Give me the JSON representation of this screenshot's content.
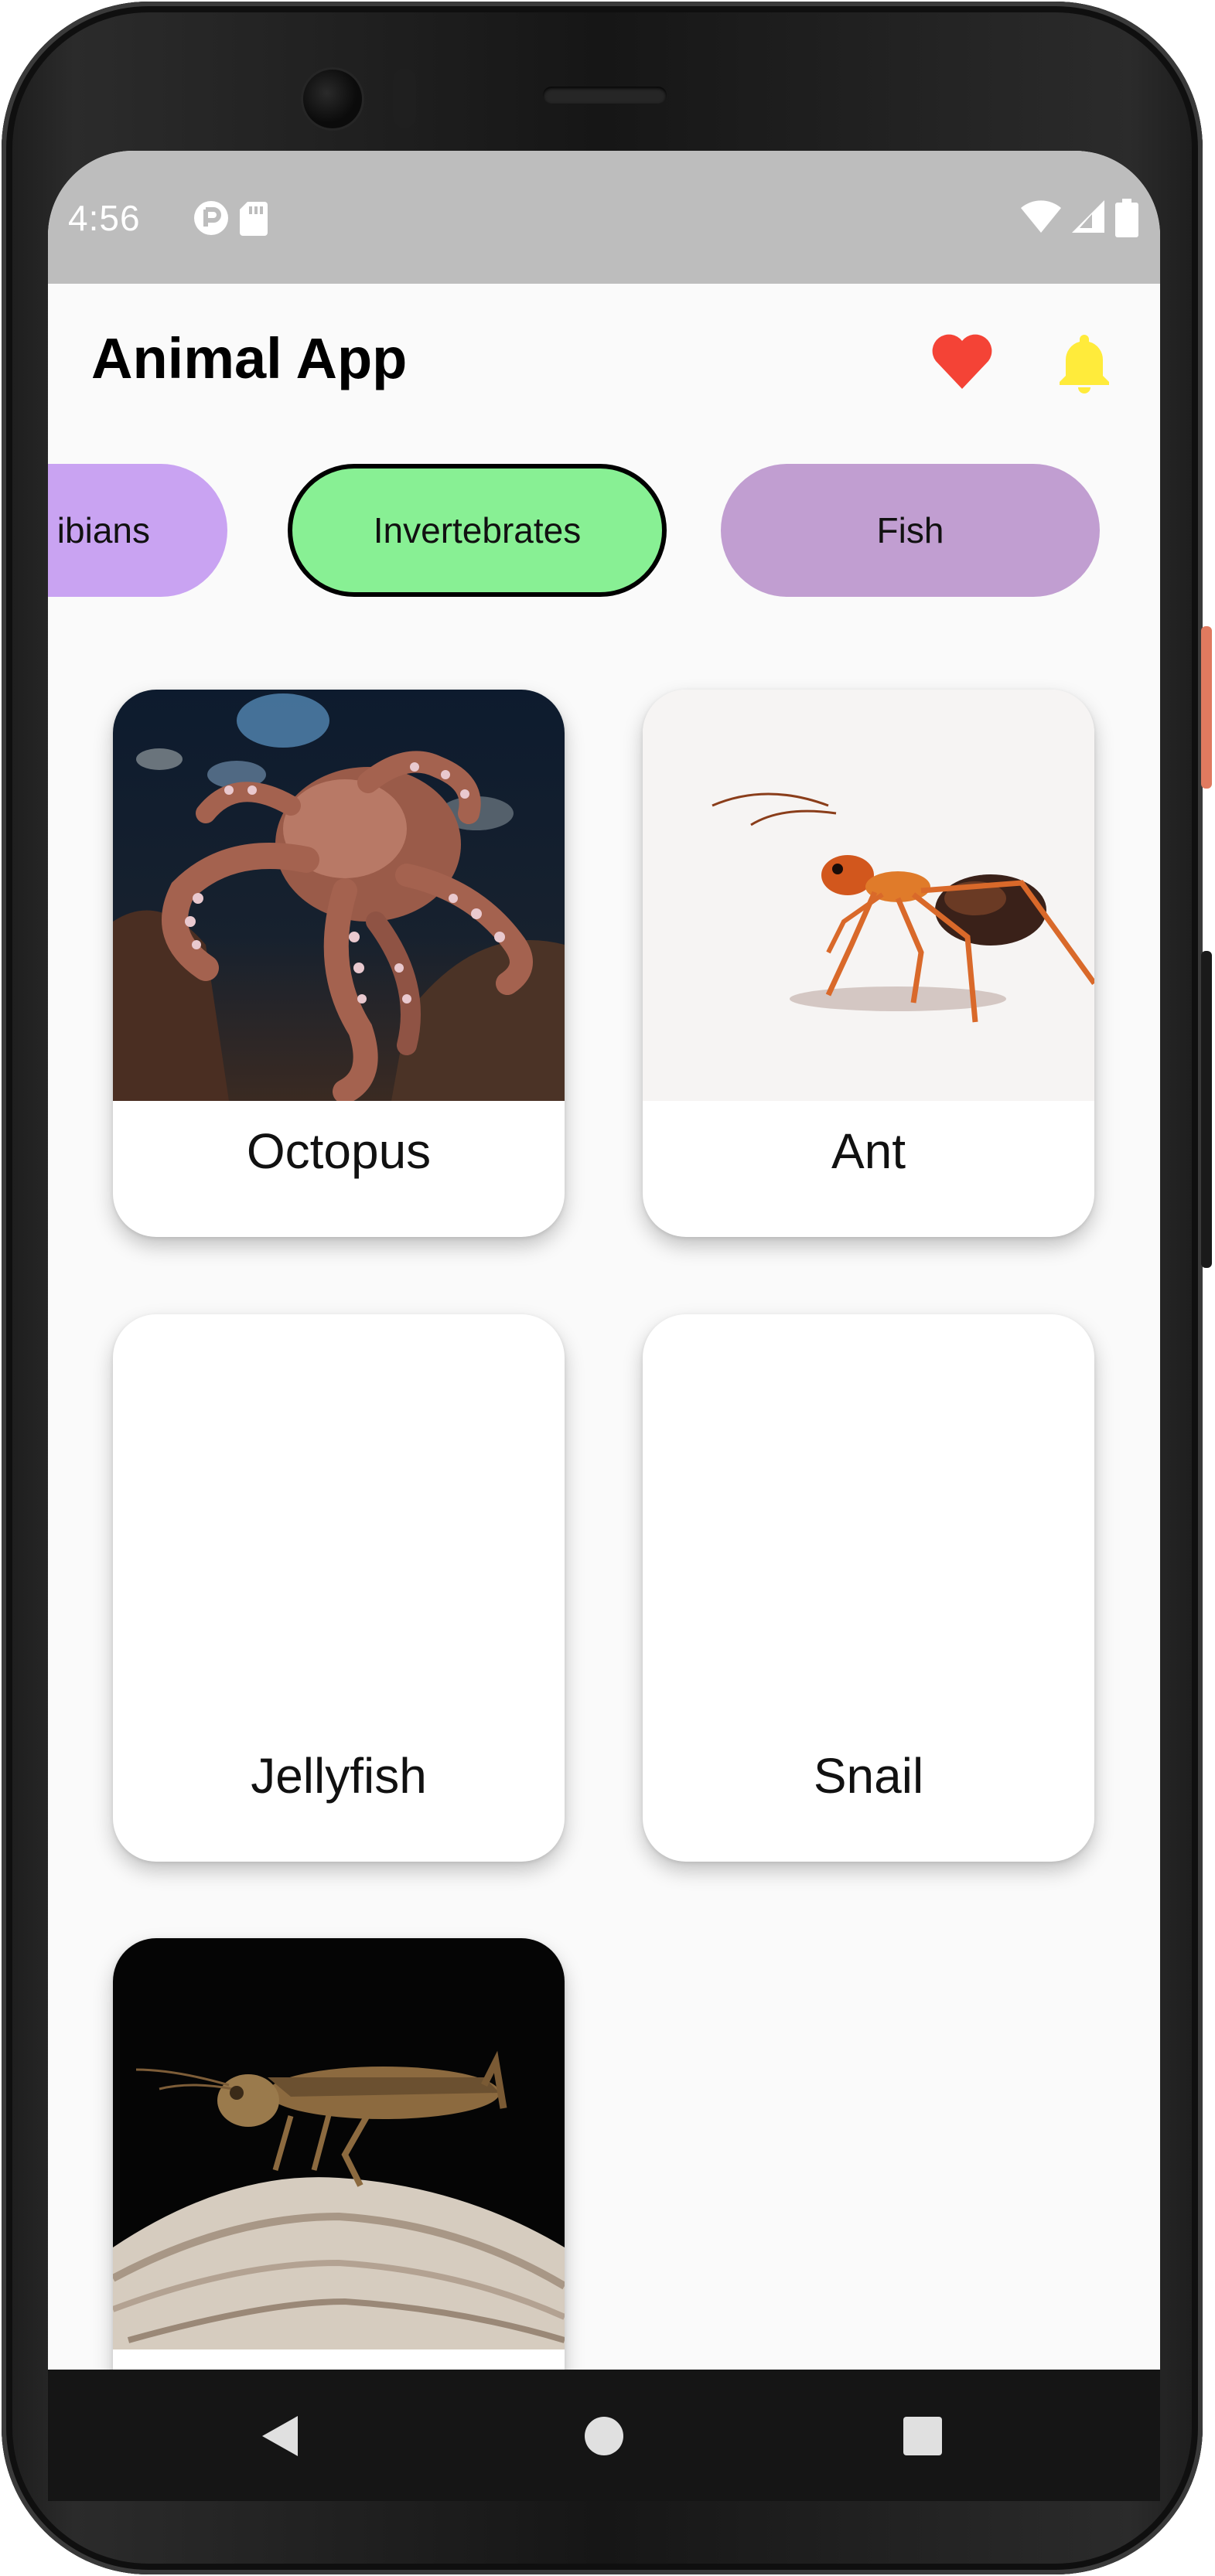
{
  "status_bar": {
    "time": "4:56",
    "icons_left": [
      "cast-icon",
      "sd-card-icon"
    ],
    "icons_right": [
      "wifi-icon",
      "signal-icon",
      "battery-icon"
    ]
  },
  "header": {
    "title": "Animal App",
    "favorite_icon": "heart-icon",
    "favorite_color": "#f44336",
    "notification_icon": "bell-icon",
    "notification_color": "#ffeb3b"
  },
  "categories": [
    {
      "label": "Amphibians",
      "visible_text": "ibians",
      "color": "#c9a3f2",
      "selected": false
    },
    {
      "label": "Invertebrates",
      "visible_text": "Invertebrates",
      "color": "#88f094",
      "selected": true
    },
    {
      "label": "Fish",
      "visible_text": "Fish",
      "color": "#c19ed1",
      "selected": false
    }
  ],
  "animals": [
    {
      "name": "Octopus",
      "image": "octopus-photo"
    },
    {
      "name": "Ant",
      "image": "ant-photo"
    },
    {
      "name": "Jellyfish",
      "image": ""
    },
    {
      "name": "Snail",
      "image": ""
    },
    {
      "name": "",
      "image": "grasshopper-photo"
    }
  ],
  "nav_bar": {
    "back_icon": "back-icon",
    "home_icon": "home-icon",
    "recents_icon": "recents-icon"
  }
}
